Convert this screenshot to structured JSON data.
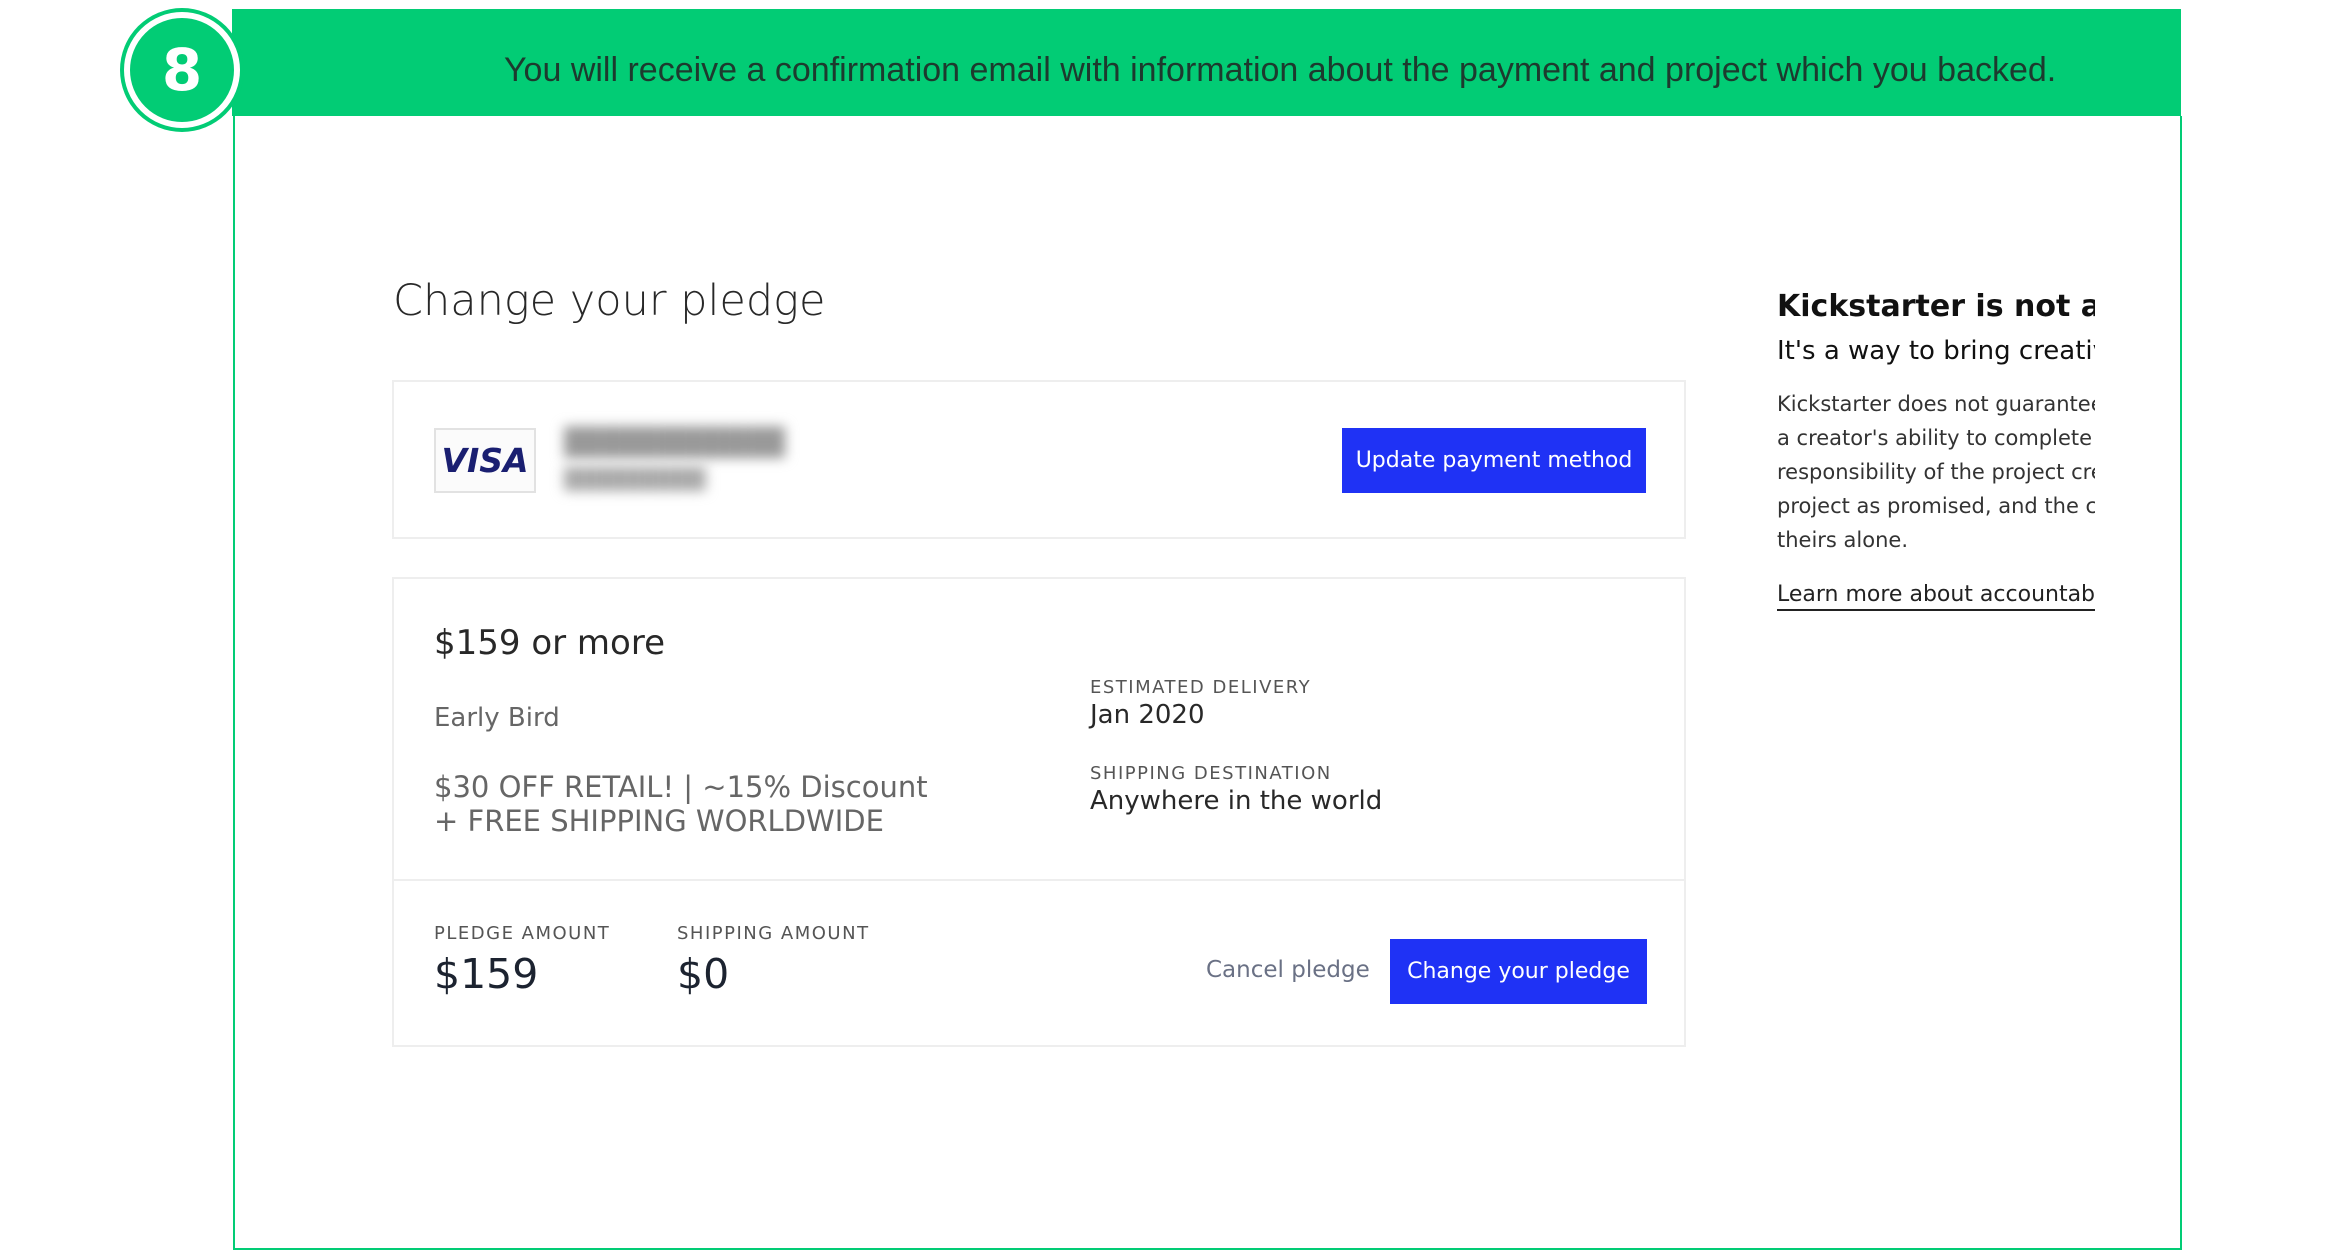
{
  "step": {
    "number": "8",
    "instruction": "You will receive a confirmation email with information about the payment and project which you backed."
  },
  "page": {
    "title": "Change your pledge"
  },
  "payment": {
    "card_brand": "VISA",
    "update_label": "Update payment method"
  },
  "reward": {
    "amount": "$159 or more",
    "name": "Early Bird",
    "description_line1": "$30 OFF RETAIL! | ~15% Discount",
    "description_line2": "+ FREE SHIPPING WORLDWIDE",
    "estimated_delivery_label": "ESTIMATED DELIVERY",
    "estimated_delivery_value": "Jan 2020",
    "shipping_destination_label": "SHIPPING DESTINATION",
    "shipping_destination_value": "Anywhere in the world"
  },
  "totals": {
    "pledge_label": "PLEDGE AMOUNT",
    "pledge_value": "$159",
    "shipping_label": "SHIPPING AMOUNT",
    "shipping_value": "$0",
    "cancel_label": "Cancel pledge",
    "change_label": "Change your pledge"
  },
  "aside": {
    "title": "Kickstarter is not a stor",
    "subtitle": "It's a way to bring creative",
    "body_lines": [
      "Kickstarter does not guarantee",
      "a creator's ability to complete t",
      "responsibility of the project cre",
      "project as promised, and the cl",
      "theirs alone."
    ],
    "link": "Learn more about accountabili"
  },
  "colors": {
    "banner_green": "#02cc75",
    "primary_button": "#1f32f5"
  }
}
